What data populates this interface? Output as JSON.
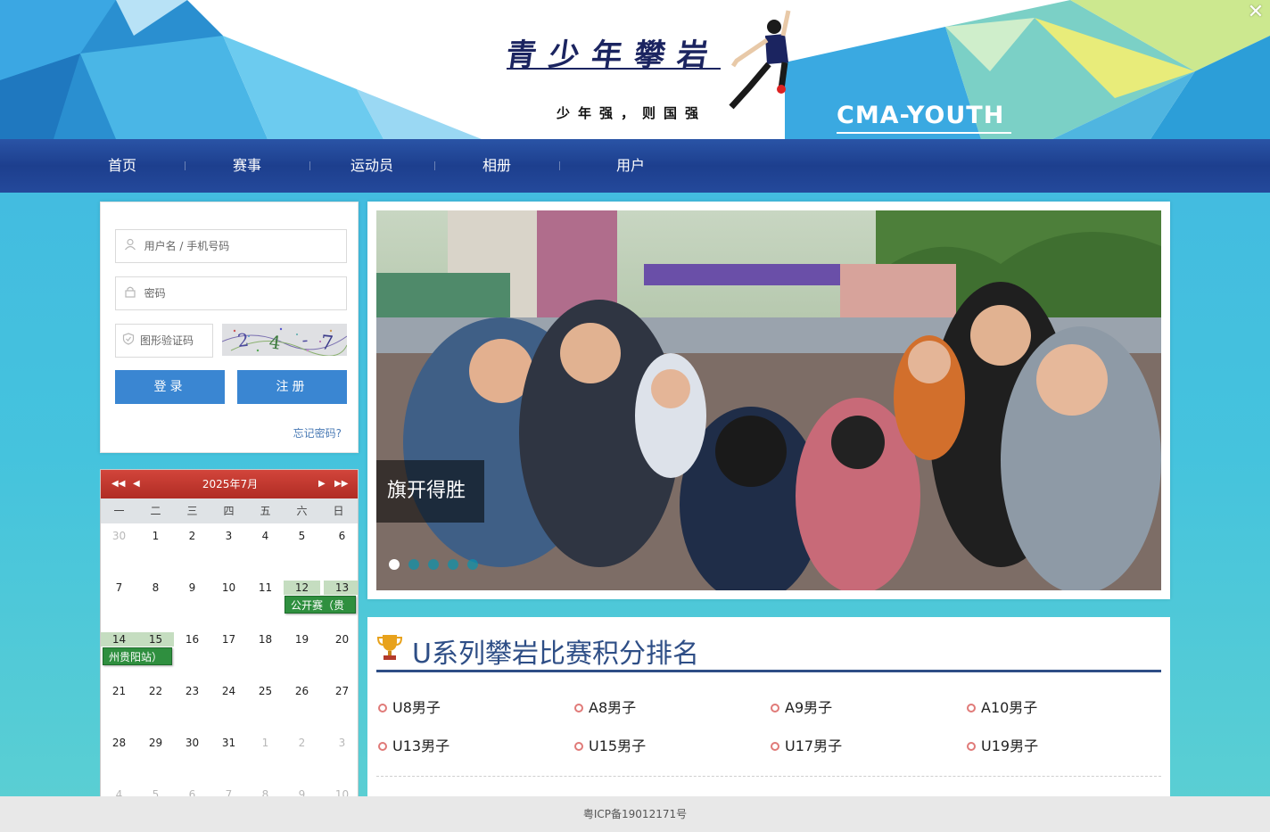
{
  "banner": {
    "title": "青少年攀岩",
    "slogan": "少年强，则国强",
    "brand": "CMA-YOUTH",
    "close_label": "✕"
  },
  "nav": {
    "items": [
      {
        "label": "首页"
      },
      {
        "label": "赛事"
      },
      {
        "label": "运动员"
      },
      {
        "label": "相册"
      },
      {
        "label": "用户"
      }
    ]
  },
  "login": {
    "username_placeholder": "用户名 / 手机号码",
    "password_placeholder": "密码",
    "captcha_placeholder": "图形验证码",
    "captcha_text": "2 4 7",
    "login_label": "登录",
    "register_label": "注册",
    "forgot_label": "忘记密码?"
  },
  "calendar": {
    "month_label": "2025年7月",
    "prev_year": "◀◀",
    "prev_month": "◀",
    "next_month": "▶",
    "next_year": "▶▶",
    "weekdays": [
      "一",
      "二",
      "三",
      "四",
      "五",
      "六",
      "日"
    ],
    "weeks": [
      [
        "30",
        "1",
        "2",
        "3",
        "4",
        "5",
        "6"
      ],
      [
        "7",
        "8",
        "9",
        "10",
        "11",
        "12",
        "13"
      ],
      [
        "14",
        "15",
        "16",
        "17",
        "18",
        "19",
        "20"
      ],
      [
        "21",
        "22",
        "23",
        "24",
        "25",
        "26",
        "27"
      ],
      [
        "28",
        "29",
        "30",
        "31",
        "1",
        "2",
        "3"
      ],
      [
        "4",
        "5",
        "6",
        "7",
        "8",
        "9",
        "10"
      ]
    ],
    "event_part1": "公开赛（贵",
    "event_part2": "州贵阳站）"
  },
  "carousel": {
    "caption": "旗开得胜",
    "slides": 5,
    "active_slide": 1
  },
  "ranking": {
    "title": "U系列攀岩比赛积分排名",
    "items": [
      "U8男子",
      "A8男子",
      "A9男子",
      "A10男子",
      "U13男子",
      "U15男子",
      "U17男子",
      "U19男子"
    ]
  },
  "footer": {
    "icp": "粤ICP备19012171号"
  },
  "colors": {
    "nav_blue": "#1d3f8e",
    "button_blue": "#3a86d2",
    "calendar_red": "#b02c24",
    "event_green": "#2f8f3f",
    "title_blue": "#2e4e86"
  }
}
